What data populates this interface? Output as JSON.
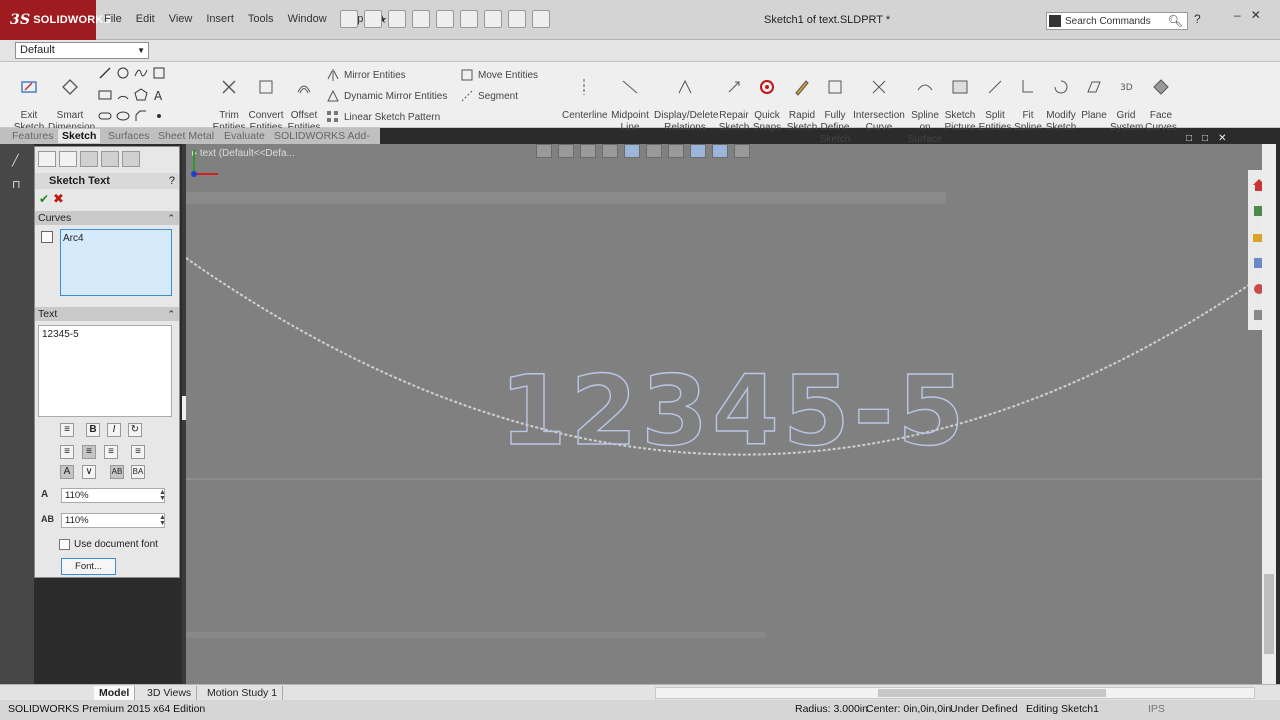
{
  "app": {
    "logo_text": "SOLIDWORKS",
    "logo_mark": "3S",
    "doc_title": "Sketch1 of text.SLDPRT *"
  },
  "menu": [
    "File",
    "Edit",
    "View",
    "Insert",
    "Tools",
    "Window",
    "Help"
  ],
  "search": {
    "placeholder": "Search Commands"
  },
  "config": {
    "selected": "Default"
  },
  "ribbon": {
    "exit_sketch": "Exit\nSketch",
    "smart_dimension": "Smart\nDimension",
    "trim_entities": "Trim\nEntities",
    "convert_entities": "Convert\nEntities",
    "offset_entities": "Offset\nEntities",
    "mirror_entities": "Mirror Entities",
    "dynamic_mirror": "Dynamic Mirror Entities",
    "linear_pattern": "Linear Sketch Pattern",
    "move_entities": "Move Entities",
    "segment": "Segment",
    "centerline": "Centerline",
    "midpoint_line": "Midpoint\nLine",
    "display_delete": "Display/Delete\nRelations",
    "repair_sketch": "Repair\nSketch",
    "quick_snaps": "Quick\nSnaps",
    "rapid_sketch": "Rapid\nSketch",
    "fully_define": "Fully\nDefine\nSketch",
    "intersection_curve": "Intersection\nCurve",
    "spline_on_surface": "Spline\non\nSurface",
    "sketch_picture": "Sketch\nPicture",
    "split_entities": "Split\nEntities",
    "fit_spline": "Fit\nSpline",
    "modify_sketch": "Modify\nSketch",
    "plane": "Plane",
    "grid_system": "Grid\nSystem",
    "face_curves": "Face\nCurves"
  },
  "tabs": [
    "Features",
    "Sketch",
    "Surfaces",
    "Sheet Metal",
    "Evaluate",
    "SOLIDWORKS Add-Ins"
  ],
  "active_tab": "Sketch",
  "property_manager": {
    "title": "Sketch Text",
    "help": "?",
    "curves_header": "Curves",
    "curves_items": [
      "Arc4"
    ],
    "text_header": "Text",
    "text_value": "12345-5",
    "width_factor": "110%",
    "spacing": "110%",
    "use_document_font": "Use document font",
    "font_button": "Font..."
  },
  "graphics": {
    "tree_flyout": "text (Default<<Defa...",
    "sketch_text": "12345-5"
  },
  "bottom_tabs": [
    "Model",
    "3D Views",
    "Motion Study 1"
  ],
  "active_bottom_tab": "Model",
  "status": {
    "edition": "SOLIDWORKS Premium 2015 x64 Edition",
    "radius": "Radius: 3.000in",
    "center": "Center: 0in,0in,0in",
    "defined": "Under Defined",
    "editing": "Editing Sketch1",
    "units": "IPS"
  },
  "colors": {
    "logo_bg": "#9e1b20",
    "graphics_bg": "#808080",
    "selection_blue": "#3a8ed8",
    "ok_green": "#1b8a1b",
    "cancel_red": "#c01616"
  }
}
